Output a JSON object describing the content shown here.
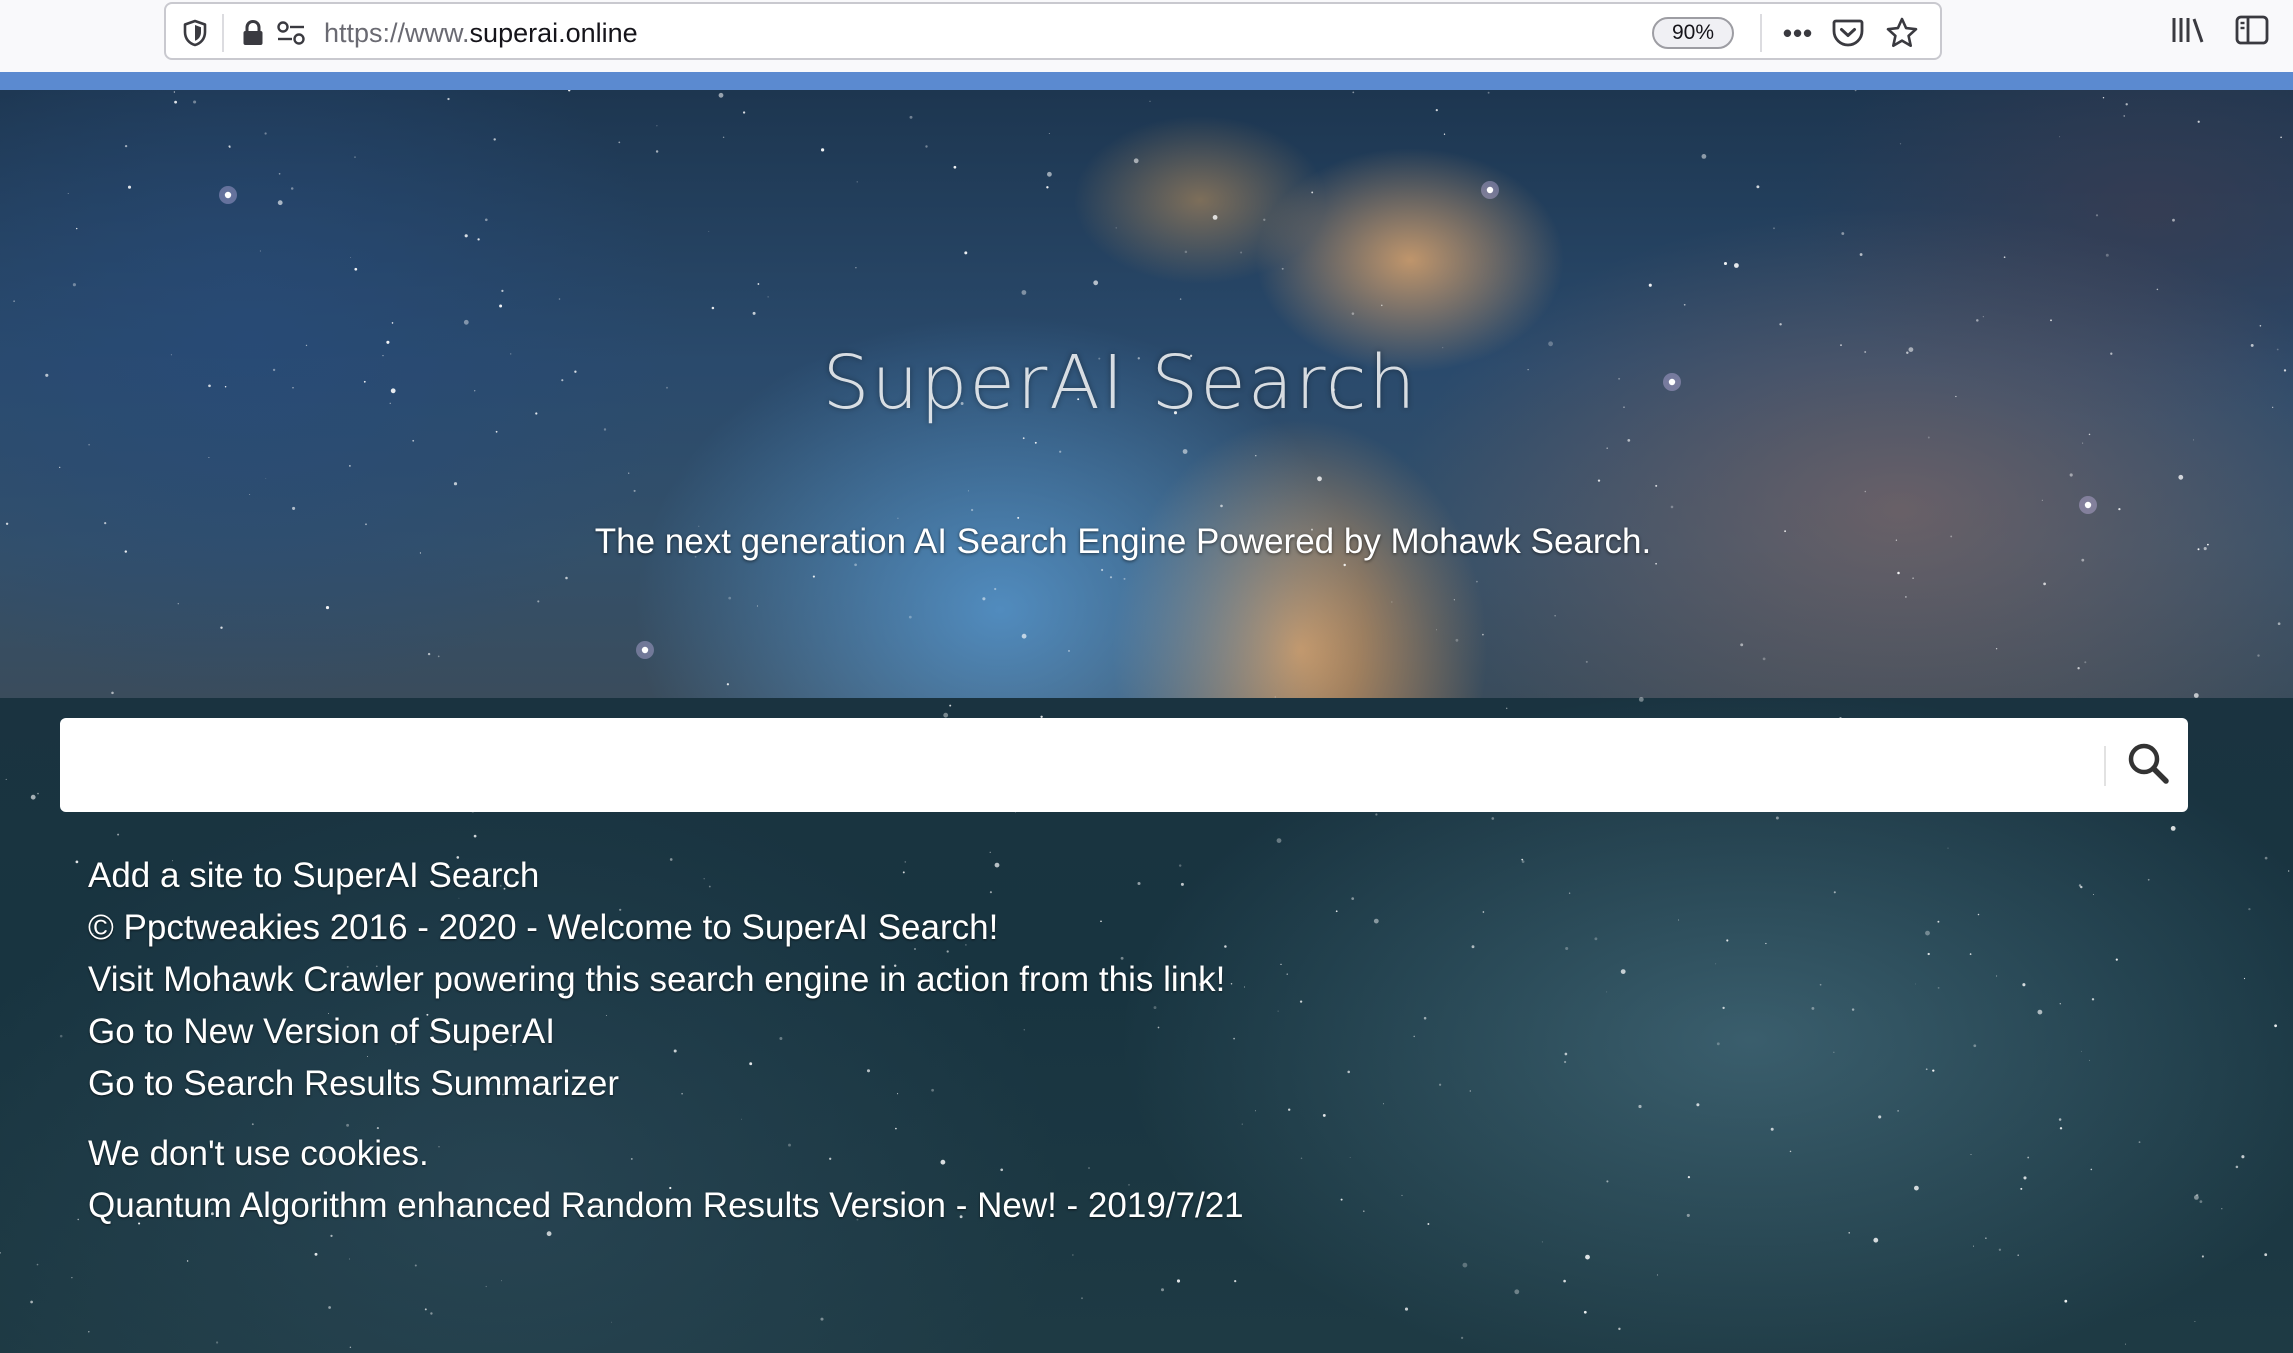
{
  "browser": {
    "url_prefix": "https://www.",
    "url_host": "superai.online",
    "zoom": "90%",
    "more_icon": "•••",
    "icons": {
      "shield": "shield-icon",
      "lock": "lock-icon",
      "permissions": "permissions-icon",
      "pocket": "pocket-icon",
      "bookmark": "star-icon",
      "library": "library-icon",
      "sidebar": "sidebar-icon"
    }
  },
  "hero": {
    "title": "SuperAI Search",
    "tagline": "The next generation AI Search Engine Powered by Mohawk Search."
  },
  "search": {
    "value": "",
    "placeholder": "",
    "button_icon": "search-icon"
  },
  "links": {
    "add_site": "Add a site to SuperAI Search",
    "copyright": "© Ppctweakies 2016 - 2020 - Welcome to SuperAI Search!",
    "mohawk_crawler": "Visit Mohawk Crawler powering this search engine in action from this link!",
    "new_version": "Go to New Version of SuperAI",
    "summarizer": "Go to Search Results Summarizer",
    "cookies": "We don't use cookies.",
    "quantum": "Quantum Algorithm enhanced Random Results Version - New! - 2019/7/21"
  },
  "colors": {
    "accent_bar": "#5b8ad0",
    "toolbar_bg": "#f9f9fb",
    "text_white": "#ffffff"
  }
}
